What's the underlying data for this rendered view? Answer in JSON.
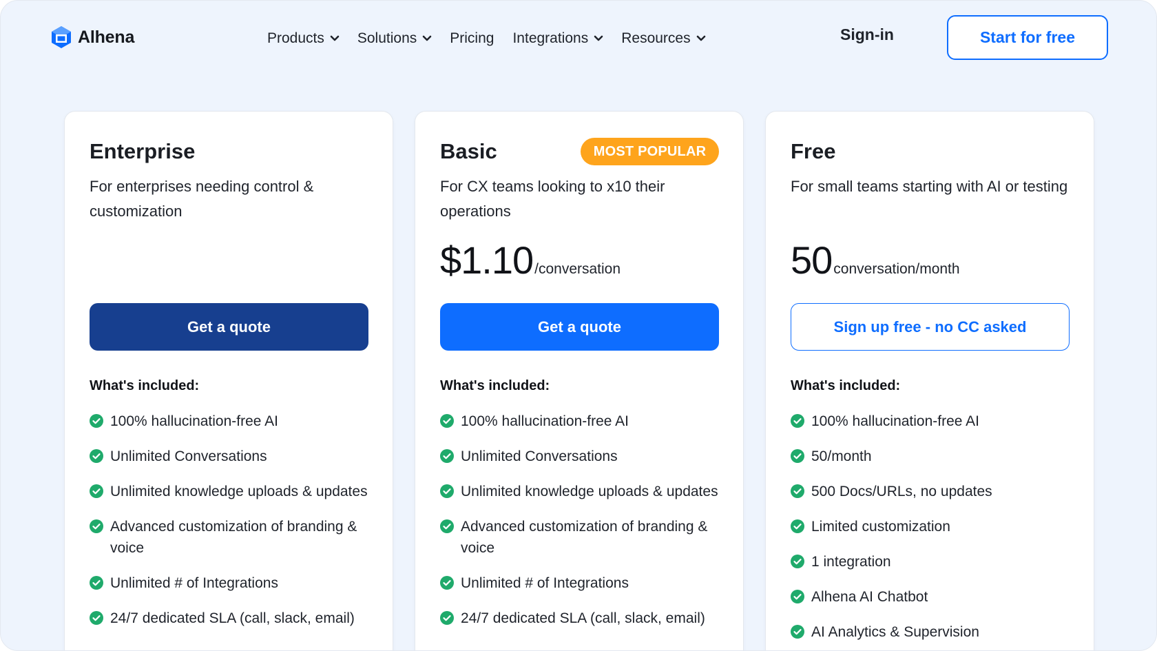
{
  "header": {
    "logo_text": "Alhena",
    "nav": [
      {
        "label": "Products",
        "dropdown": true
      },
      {
        "label": "Solutions",
        "dropdown": true
      },
      {
        "label": "Pricing",
        "dropdown": false
      },
      {
        "label": "Integrations",
        "dropdown": true
      },
      {
        "label": "Resources",
        "dropdown": true
      }
    ],
    "signin_label": "Sign-in",
    "start_label": "Start for free"
  },
  "colors": {
    "brand_blue": "#0e6dff",
    "enterprise_navy": "#173f8f",
    "badge_orange": "#fea41c",
    "check_green": "#1faa6b",
    "page_bg": "#eef4fd"
  },
  "plans": [
    {
      "name": "Enterprise",
      "description": "For enterprises needing control & customization",
      "badge": "",
      "price_amount": "",
      "price_unit": "",
      "cta_label": "Get a quote",
      "included_title": "What's included:",
      "features": [
        "100% hallucination-free AI",
        "Unlimited Conversations",
        "Unlimited knowledge uploads & updates",
        "Advanced customization of branding & voice",
        "Unlimited # of Integrations",
        "24/7 dedicated SLA (call, slack, email)"
      ]
    },
    {
      "name": "Basic",
      "description": "For CX teams looking to x10 their operations",
      "badge": "MOST POPULAR",
      "price_amount": "$1.10",
      "price_unit": "/conversation",
      "cta_label": "Get a quote",
      "included_title": "What's included:",
      "features": [
        "100% hallucination-free AI",
        "Unlimited Conversations",
        "Unlimited knowledge uploads & updates",
        "Advanced customization of branding & voice",
        "Unlimited # of Integrations",
        "24/7 dedicated SLA (call, slack, email)"
      ]
    },
    {
      "name": "Free",
      "description": "For small teams starting with AI or testing",
      "badge": "",
      "price_amount": "50",
      "price_unit": "conversation/month",
      "cta_label": "Sign up free - no CC asked",
      "included_title": "What's included:",
      "features": [
        "100% hallucination-free AI",
        "50/month",
        "500 Docs/URLs, no updates",
        "Limited customization",
        "1 integration",
        "Alhena AI Chatbot",
        "AI Analytics & Supervision"
      ]
    }
  ]
}
